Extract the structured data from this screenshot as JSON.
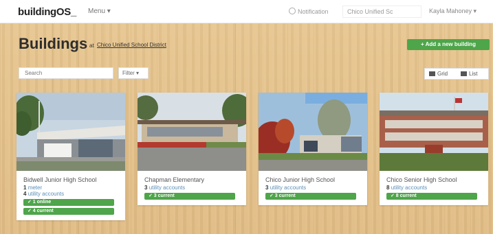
{
  "header": {
    "logo": "buildingOS_",
    "menu": "Menu ▾",
    "notification": "Notification",
    "district_select": "Chico Unified Sc",
    "user": "Kayla Mahoney ▾"
  },
  "page": {
    "title": "Buildings",
    "at": "at",
    "district": "Chico Unified School District",
    "add_building": "+ Add a new building",
    "search_placeholder": "Search",
    "filter": "Filter ▾",
    "grid": "Grid",
    "list": "List"
  },
  "cards": [
    {
      "name": "Bidwell Junior High School",
      "meters_count": "1",
      "meters_label": "meter",
      "accounts_count": "4",
      "accounts_label": "utility accounts",
      "badges": [
        "✓ 1 online",
        "✓ 4 current"
      ]
    },
    {
      "name": "Chapman Elementary",
      "accounts_count": "3",
      "accounts_label": "utility accounts",
      "badges": [
        "✓ 3 current"
      ]
    },
    {
      "name": "Chico Junior High School",
      "accounts_count": "3",
      "accounts_label": "utility accounts",
      "badges": [
        "✓ 3 current"
      ]
    },
    {
      "name": "Chico Senior High School",
      "accounts_count": "8",
      "accounts_label": "utility accounts",
      "badges": [
        "✓ 8 current"
      ]
    }
  ],
  "colors": {
    "accent_green": "#4ea54a",
    "wood": "#e4c18b",
    "link": "#5b8fb8"
  },
  "icons": [
    "bell-icon",
    "grid-icon",
    "list-icon",
    "checkmark-icon"
  ]
}
